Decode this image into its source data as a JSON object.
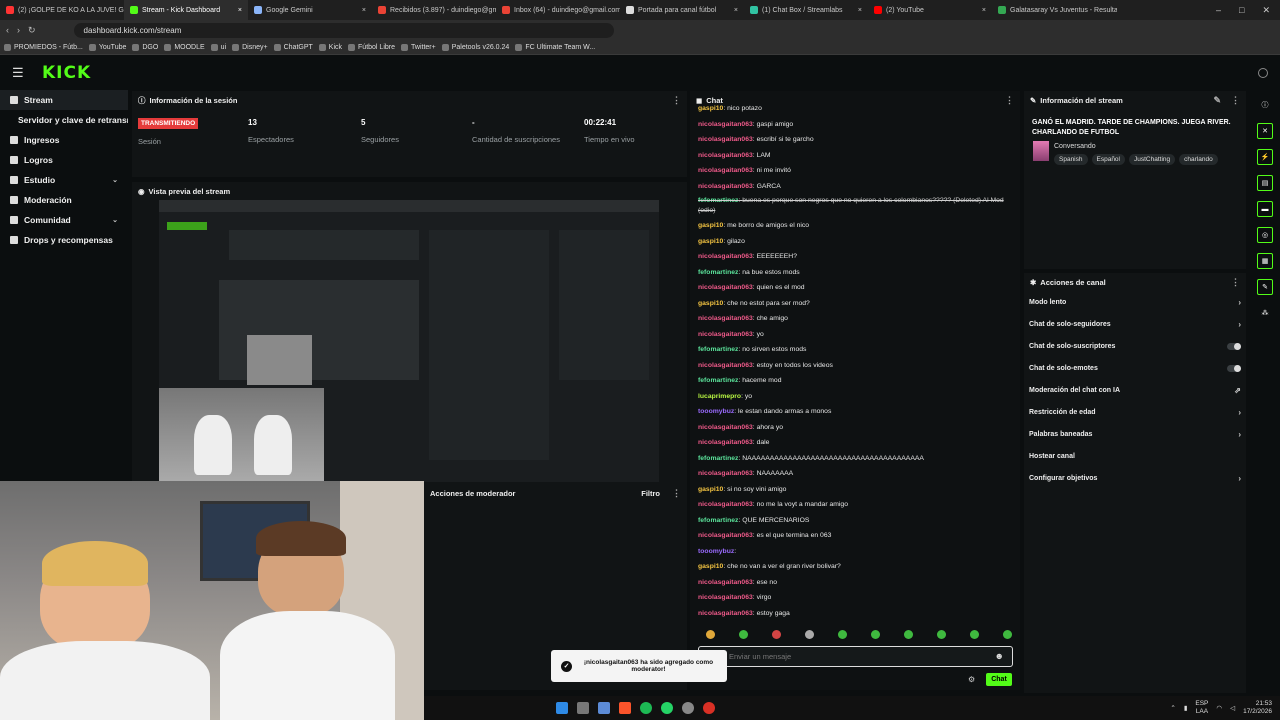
{
  "browser": {
    "tabs": [
      {
        "label": "(2) ¡GOLPE DE KO A LA JUVE! GALAT",
        "color": "#ff3333",
        "active": false
      },
      {
        "label": "Stream - Kick Dashboard",
        "color": "#53fc18",
        "active": true
      },
      {
        "label": "Google Gemini",
        "color": "#8ab4f8",
        "active": false
      },
      {
        "label": "Recibidos (3.897) - duindiego@gmai",
        "color": "#ea4335",
        "active": false
      },
      {
        "label": "Inbox (64) - duindiego@gmail.com",
        "color": "#ea4335",
        "active": false
      },
      {
        "label": "Portada para canal fútbol",
        "color": "#dddddd",
        "active": false
      },
      {
        "label": "(1) Chat Box / Streamlabs",
        "color": "#31c3a2",
        "active": false
      },
      {
        "label": "(2) YouTube",
        "color": "#ff0000",
        "active": false
      },
      {
        "label": "Galatasaray Vs Juventus - Resultado",
        "color": "#34a853",
        "active": false
      }
    ],
    "url": "dashboard.kick.com/stream",
    "bookmarks": [
      "PROMIEDOS - Fútb...",
      "YouTube",
      "DGO",
      "MOODLE",
      "ui",
      "Disney+",
      "ChatGPT",
      "Kick",
      "Fútbol Libre",
      "Twitter+",
      "Paletools v26.0.24",
      "FC Ultimate Team W..."
    ]
  },
  "sidebar": {
    "items": [
      {
        "label": "Stream",
        "chevron": ""
      },
      {
        "label": "Servidor y clave de retransmisión",
        "chevron": ""
      },
      {
        "label": "Ingresos",
        "chevron": ""
      },
      {
        "label": "Logros",
        "chevron": ""
      },
      {
        "label": "Estudio",
        "chevron": "⌄"
      },
      {
        "label": "Moderación",
        "chevron": ""
      },
      {
        "label": "Comunidad",
        "chevron": "⌄"
      },
      {
        "label": "Drops y recompensas",
        "chevron": ""
      }
    ]
  },
  "session": {
    "title": "Información de la sesión",
    "status": "TRANSMITIENDO",
    "status_label": "Sesión",
    "stats": [
      {
        "value": "13",
        "label": "Espectadores"
      },
      {
        "value": "5",
        "label": "Seguidores"
      },
      {
        "value": "-",
        "label": "Cantidad de suscripciones"
      },
      {
        "value": "00:22:41",
        "label": "Tiempo en vivo"
      }
    ]
  },
  "preview": {
    "title": "Vista previa del stream"
  },
  "mod_actions": {
    "title": "Acciones de moderador",
    "filter": "Filtro"
  },
  "chat": {
    "title": "Chat",
    "messages": [
      {
        "user": "gaspi10",
        "text": "nico potazo",
        "color": "#f5c542"
      },
      {
        "user": "nicolasgaitan063",
        "text": "gaspi amigo",
        "color": "#f05a8a"
      },
      {
        "user": "nicolasgaitan063",
        "text": "escribí si te garcho",
        "color": "#f05a8a"
      },
      {
        "user": "nicolasgaitan063",
        "text": "LAM",
        "color": "#f05a8a"
      },
      {
        "user": "nicolasgaitan063",
        "text": "ni me invitó",
        "color": "#f05a8a"
      },
      {
        "user": "nicolasgaitan063",
        "text": "GARCA",
        "color": "#f05a8a"
      },
      {
        "user": "fefomartinez",
        "text": "buena es porque son negros que no quieren a los colombianos????? (Deleted) Al Mod (odio)",
        "color": "#5be39b",
        "struck": true
      },
      {
        "user": "gaspi10",
        "text": "me borro de amigos el nico",
        "color": "#f5c542"
      },
      {
        "user": "gaspi10",
        "text": "gilazo",
        "color": "#f5c542"
      },
      {
        "user": "nicolasgaitan063",
        "text": "EEEEEEEH?",
        "color": "#f05a8a"
      },
      {
        "user": "fefomartinez",
        "text": "na bue estos mods",
        "color": "#5be39b"
      },
      {
        "user": "nicolasgaitan063",
        "text": "quien es el mod",
        "color": "#f05a8a"
      },
      {
        "user": "gaspi10",
        "text": "che no estot para ser mod?",
        "color": "#f5c542"
      },
      {
        "user": "nicolasgaitan063",
        "text": "che amigo",
        "color": "#f05a8a"
      },
      {
        "user": "nicolasgaitan063",
        "text": "yo",
        "color": "#f05a8a"
      },
      {
        "user": "fefomartinez",
        "text": "no sirven estos mods",
        "color": "#5be39b"
      },
      {
        "user": "nicolasgaitan063",
        "text": "estoy en todos los videos",
        "color": "#f05a8a"
      },
      {
        "user": "fefomartinez",
        "text": "haceme mod",
        "color": "#5be39b"
      },
      {
        "user": "lucaprimepro",
        "text": "yo",
        "color": "#b7f542"
      },
      {
        "user": "tooomybuz",
        "text": "le estan dando armas a monos",
        "color": "#9a6bff"
      },
      {
        "user": "nicolasgaitan063",
        "text": "ahora yo",
        "color": "#f05a8a"
      },
      {
        "user": "nicolasgaitan063",
        "text": "dale",
        "color": "#f05a8a"
      },
      {
        "user": "fefomartinez",
        "text": "NAAAAAAAAAAAAAAAAAAAAAAAAAAAAAAAAAAAAAAA",
        "color": "#5be39b"
      },
      {
        "user": "nicolasgaitan063",
        "text": "NAAAAAAA",
        "color": "#f05a8a"
      },
      {
        "user": "gaspi10",
        "text": "si no soy vini amigo",
        "color": "#f5c542"
      },
      {
        "user": "nicolasgaitan063",
        "text": "no me la voyt a mandar amigo",
        "color": "#f05a8a"
      },
      {
        "user": "fefomartinez",
        "text": "QUE MERCENARIOS",
        "color": "#5be39b"
      },
      {
        "user": "nicolasgaitan063",
        "text": "es el que termina en 063",
        "color": "#f05a8a"
      },
      {
        "user": "tooomybuz",
        "text": "",
        "color": "#9a6bff"
      },
      {
        "user": "gaspi10",
        "text": "che no van a ver el gran river bolivar?",
        "color": "#f5c542"
      },
      {
        "user": "nicolasgaitan063",
        "text": "ese no",
        "color": "#f05a8a"
      },
      {
        "user": "nicolasgaitan063",
        "text": "virgo",
        "color": "#f05a8a"
      },
      {
        "user": "nicolasgaitan063",
        "text": "estoy gaga",
        "color": "#f05a8a"
      }
    ],
    "input_placeholder": "Enviar un mensaje",
    "send_label": "Chat"
  },
  "toast": {
    "text": "¡nicolasgaitan063 ha sido agregado como moderator!"
  },
  "stream_info": {
    "title": "Información del stream",
    "stream_title": "GANÓ EL MADRID. TARDE DE CHAMPIONS. JUEGA RIVER. CHARLANDO DE FUTBOL",
    "category": "Conversando",
    "tags": [
      "Spanish",
      "Español",
      "JustChatting",
      "charlando"
    ]
  },
  "channel_actions": {
    "title": "Acciones de canal",
    "items": [
      {
        "label": "Modo lento",
        "control": "arrow"
      },
      {
        "label": "Chat de solo-seguidores",
        "control": "arrow"
      },
      {
        "label": "Chat de solo-suscriptores",
        "control": "toggle"
      },
      {
        "label": "Chat de solo-emotes",
        "control": "toggle"
      },
      {
        "label": "Moderación del chat con IA",
        "control": "external"
      },
      {
        "label": "Restricción de edad",
        "control": "arrow"
      },
      {
        "label": "Palabras baneadas",
        "control": "arrow"
      },
      {
        "label": "Hostear canal",
        "control": "none"
      },
      {
        "label": "Configurar objetivos",
        "control": "arrow"
      }
    ]
  },
  "taskbar": {
    "lang": "ESP",
    "lang2": "LAA",
    "time": "21:53",
    "date": "17/2/2026"
  }
}
